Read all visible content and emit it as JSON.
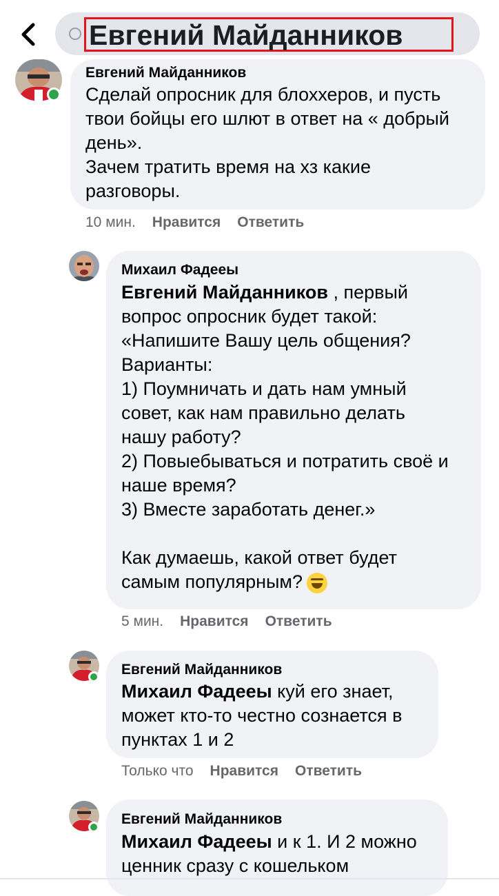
{
  "header": {
    "search_query": "Евгений Майданников"
  },
  "comments": [
    {
      "author": "Евгений Майданников",
      "text": "Сделай опросник для блоххеров, и пусть\nтвои бойцы его шлют в ответ на « добрый\nдень».\nЗачем тратить время  на хз какие\nразговоры.",
      "time": "10 мин.",
      "like": "Нравится",
      "reply": "Ответить"
    },
    {
      "author": "Михаил Фадееы",
      "mention": "Евгений Майданников",
      "text_after_mention": " , первый\nвопрос опросник будет такой:\n«Напишите Вашу цель общения?\nВарианты:\n1) Поумничать и дать нам умный\nсовет, как нам правильно делать\nнашу работу?\n2) Повыебываться и потратить своё и\nнаше время?\n3) Вместе заработать денег.»\n\nКак думаешь, какой ответ будет\nсамым популярным?",
      "emoji": "grinning-squinting-face",
      "time": "5 мин.",
      "like": "Нравится",
      "reply": "Ответить"
    },
    {
      "author": "Евгений Майданников",
      "mention": "Михаил Фадееы",
      "text_after_mention": "  куй его знает,\nможет кто-то честно сознается в\nпунктах 1 и 2",
      "time": "Только что",
      "like": "Нравится",
      "reply": "Ответить"
    },
    {
      "author": "Евгений Майданников",
      "mention": "Михаил Фадееы",
      "text_after_mention": "  и к 1. И 2 можно\nценник сразу с кошельком"
    }
  ],
  "colors": {
    "bubble": "#f0f2f5",
    "online": "#31a24c",
    "highlight": "#e8141b",
    "meta": "#65676b"
  }
}
